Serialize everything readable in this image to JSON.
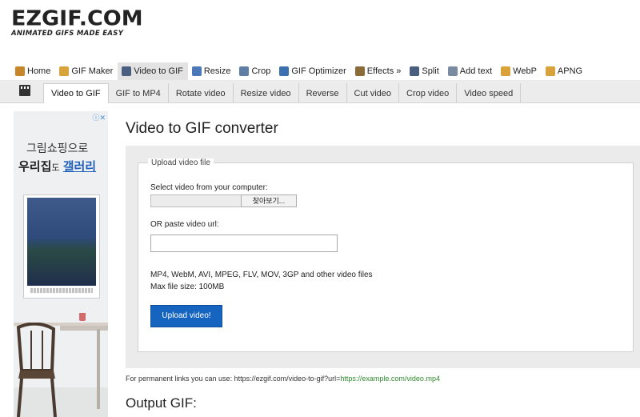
{
  "logo": {
    "main": "EZGIF.COM",
    "tagline": "ANIMATED GIFS MADE EASY"
  },
  "main_nav": [
    {
      "label": "Home",
      "icon": "home-icon",
      "color": "#c8862b"
    },
    {
      "label": "GIF Maker",
      "icon": "gif-maker-icon",
      "color": "#d9a23b"
    },
    {
      "label": "Video to GIF",
      "icon": "video-icon",
      "color": "#4a5f80",
      "active": true
    },
    {
      "label": "Resize",
      "icon": "resize-icon",
      "color": "#4a78b8"
    },
    {
      "label": "Crop",
      "icon": "crop-icon",
      "color": "#5f7ea6"
    },
    {
      "label": "GIF Optimizer",
      "icon": "optimizer-icon",
      "color": "#3a6fb0"
    },
    {
      "label": "Effects »",
      "icon": "effects-icon",
      "color": "#8b6b3a"
    },
    {
      "label": "Split",
      "icon": "split-icon",
      "color": "#4a5f80"
    },
    {
      "label": "Add text",
      "icon": "text-icon",
      "color": "#7a8aa0"
    },
    {
      "label": "WebP",
      "icon": "webp-icon",
      "color": "#d9a23b"
    },
    {
      "label": "APNG",
      "icon": "apng-icon",
      "color": "#d9a23b"
    }
  ],
  "sub_nav": [
    {
      "label": "Video to GIF",
      "active": true
    },
    {
      "label": "GIF to MP4"
    },
    {
      "label": "Rotate video"
    },
    {
      "label": "Resize video"
    },
    {
      "label": "Reverse"
    },
    {
      "label": "Cut video"
    },
    {
      "label": "Crop video"
    },
    {
      "label": "Video speed"
    }
  ],
  "ad": {
    "line1": "그림쇼핑으로",
    "line2_a": "우리집",
    "line2_b": "도",
    "line2_c": "갤러리"
  },
  "page": {
    "title": "Video to GIF converter",
    "legend": "Upload video file",
    "select_label": "Select video from your computer:",
    "browse_button": "찾아보기...",
    "url_label": "OR paste video url:",
    "url_value": "",
    "formats": "MP4, WebM, AVI, MPEG, FLV, MOV, 3GP and other video files",
    "max_size": "Max file size: 100MB",
    "upload_button": "Upload video!",
    "perm_text": "For permanent links you can use: https://ezgif.com/video-to-gif?url=",
    "perm_example": "https://example.com/video.mp4",
    "output_title": "Output GIF:"
  },
  "colors": {
    "accent": "#1565c0",
    "link_green": "#2e8b2e"
  }
}
